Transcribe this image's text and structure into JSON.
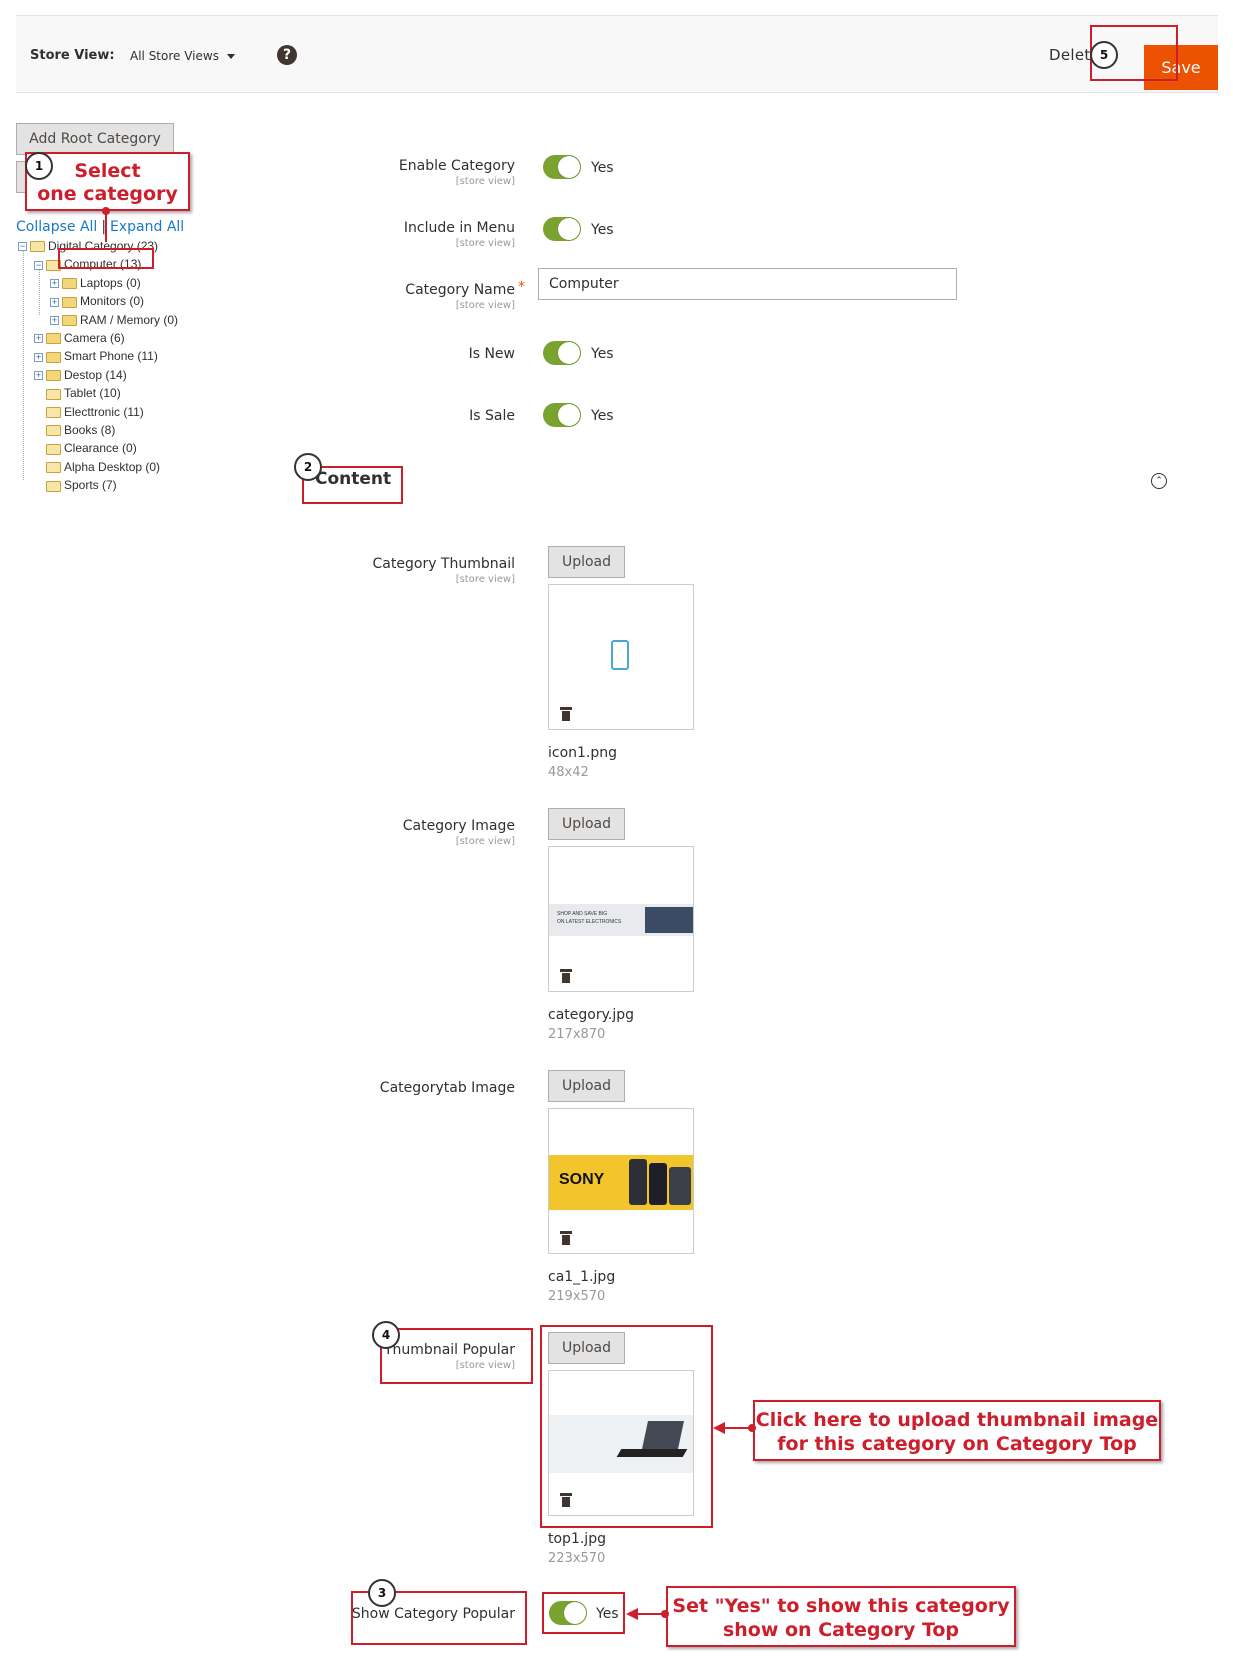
{
  "header": {
    "store_view_label": "Store View:",
    "store_view_value": "All Store Views",
    "help_icon": "?",
    "delete_label": "Delete",
    "save_label": "Save"
  },
  "sidebar": {
    "add_root_label": "Add Root Category",
    "collapse_all": "Collapse All",
    "link_separator": "|",
    "expand_all": "Expand All",
    "tree": [
      {
        "label": "Digital Category (23)",
        "level": 0,
        "expander": "minus",
        "folder": "open"
      },
      {
        "label": "Computer (13)",
        "level": 1,
        "expander": "minus",
        "folder": "open",
        "selected": true
      },
      {
        "label": "Laptops (0)",
        "level": 2,
        "expander": "plus",
        "folder": "closed"
      },
      {
        "label": "Monitors (0)",
        "level": 2,
        "expander": "plus",
        "folder": "closed"
      },
      {
        "label": "RAM / Memory (0)",
        "level": 2,
        "expander": "plus",
        "folder": "closed"
      },
      {
        "label": "Camera (6)",
        "level": 1,
        "expander": "plus",
        "folder": "closed"
      },
      {
        "label": "Smart Phone (11)",
        "level": 1,
        "expander": "plus",
        "folder": "closed"
      },
      {
        "label": "Destop (14)",
        "level": 1,
        "expander": "plus",
        "folder": "closed"
      },
      {
        "label": "Tablet (10)",
        "level": 1,
        "expander": "none",
        "folder": "open"
      },
      {
        "label": "Electtronic (11)",
        "level": 1,
        "expander": "none",
        "folder": "open"
      },
      {
        "label": "Books (8)",
        "level": 1,
        "expander": "none",
        "folder": "open"
      },
      {
        "label": "Clearance (0)",
        "level": 1,
        "expander": "none",
        "folder": "open"
      },
      {
        "label": "Alpha Desktop (0)",
        "level": 1,
        "expander": "none",
        "folder": "open"
      },
      {
        "label": "Sports (7)",
        "level": 1,
        "expander": "none",
        "folder": "open"
      }
    ]
  },
  "form": {
    "scope_text": "[store view]",
    "enable_category": {
      "label": "Enable Category",
      "value": "Yes"
    },
    "include_in_menu": {
      "label": "Include in Menu",
      "value": "Yes"
    },
    "category_name": {
      "label": "Category Name",
      "required_mark": "*",
      "value": "Computer"
    },
    "is_new": {
      "label": "Is New",
      "value": "Yes"
    },
    "is_sale": {
      "label": "Is Sale",
      "value": "Yes"
    },
    "content_title": "Content",
    "upload_label": "Upload",
    "category_thumbnail": {
      "label": "Category Thumbnail",
      "file": "icon1.png",
      "dims": "48x42"
    },
    "category_image": {
      "label": "Category Image",
      "file": "category.jpg",
      "dims": "217x870",
      "banner_line1": "SHOP AND SAVE BIG",
      "banner_line2": "ON LATEST ELECTRONICS"
    },
    "categorytab_image": {
      "label": "Categorytab Image",
      "file": "ca1_1.jpg",
      "dims": "219x570",
      "brand": "SONY"
    },
    "thumbnail_popular": {
      "label": "Thumbnail Popular",
      "file": "top1.jpg",
      "dims": "223x570"
    },
    "show_category_popular": {
      "label": "Show Category Popular",
      "value": "Yes"
    }
  },
  "annotations": {
    "step1_number": "1",
    "step1_line1": "Select",
    "step1_line2": "one category",
    "step2_number": "2",
    "step3_number": "3",
    "step4_number": "4",
    "step5_number": "5",
    "callout_upload_line1": "Click here to upload thumbnail image",
    "callout_upload_line2": "for this category on Category Top",
    "callout_yes_line1": "Set \"Yes\" to show this category",
    "callout_yes_line2": "show on Category Top"
  },
  "colors": {
    "accent": "#eb5202",
    "toggle_on": "#79a22e",
    "annotation_red": "#cc1f2b",
    "link": "#1979c3"
  }
}
